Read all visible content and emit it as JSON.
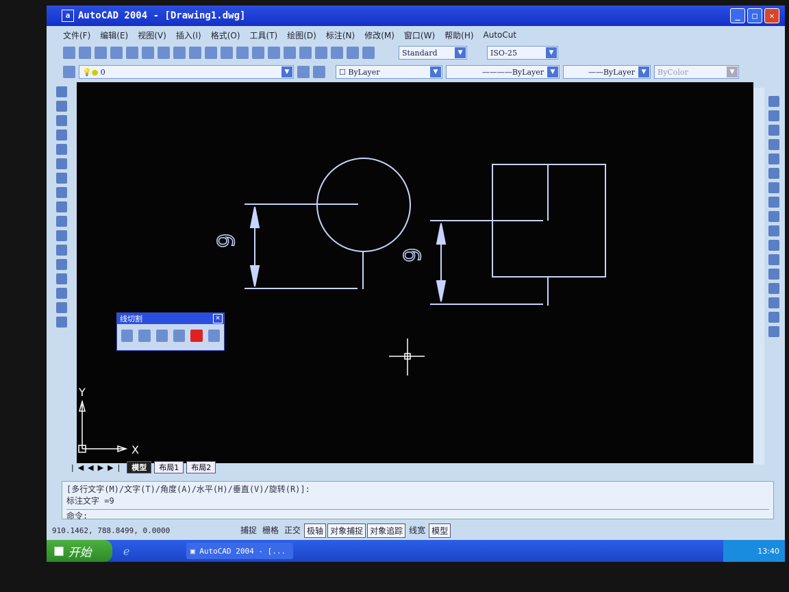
{
  "window": {
    "title": "AutoCAD 2004 - [Drawing1.dwg]",
    "app_icon": "autocad-icon"
  },
  "menu": [
    "文件(F)",
    "编辑(E)",
    "视图(V)",
    "插入(I)",
    "格式(O)",
    "工具(T)",
    "绘图(D)",
    "标注(N)",
    "修改(M)",
    "窗口(W)",
    "帮助(H)",
    "AutoCut"
  ],
  "toolbar": {
    "text_style": "Standard",
    "dim_style": "ISO-25",
    "layer": "0",
    "color": "ByLayer",
    "linetype": "ByLayer",
    "lineweight": "ByLayer",
    "plot_style": "ByColor"
  },
  "drawing": {
    "dim_text_left": "9",
    "dim_text_right": "9",
    "ucs_x": "X",
    "ucs_y": "Y",
    "line_color": "#c8d4ff"
  },
  "float_toolbar": {
    "title": "线切割"
  },
  "tabs": [
    "模型",
    "布局1",
    "布局2"
  ],
  "command": {
    "line1": "[多行文字(M)/文字(T)/角度(A)/水平(H)/垂直(V)/旋转(R)]:",
    "line2": "标注文字 =9",
    "prompt": "命令:"
  },
  "status": {
    "coords": "910.1462, 788.8499, 0.0000",
    "buttons": [
      "捕捉",
      "栅格",
      "正交",
      "极轴",
      "对象捕捉",
      "对象追踪",
      "线宽",
      "模型"
    ],
    "active": [
      "极轴",
      "对象捕捉",
      "对象追踪",
      "模型"
    ]
  },
  "taskbar": {
    "start": "开始",
    "task": "AutoCAD 2004 - [...",
    "clock": "13:40"
  }
}
